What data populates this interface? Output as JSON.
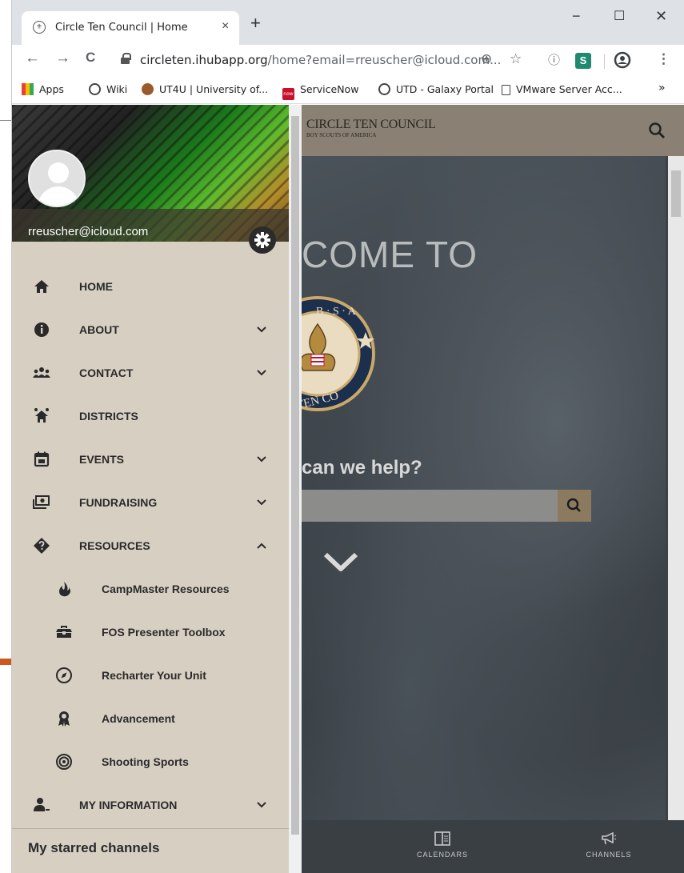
{
  "browser": {
    "tab_title": "Circle Ten Council | Home",
    "tab_close": "×",
    "new_tab": "+",
    "window_controls": {
      "minimize": "−",
      "maximize": "☐",
      "close": "✕"
    },
    "nav": {
      "back": "←",
      "forward": "→",
      "reload": "C"
    },
    "url_host": "circleten.ihubapp.org",
    "url_path": "/home?email=rreuscher@icloud.com...",
    "bookmarks": [
      "Apps",
      "Wiki",
      "UT4U | University of...",
      "ServiceNow",
      "UTD - Galaxy Portal",
      "VMware Server Acc..."
    ],
    "bookmarks_more": "»",
    "servicenow_badge": "now"
  },
  "site": {
    "brand": "CIRCLE TEN COUNCIL",
    "brand_sub": "BOY SCOUTS OF AMERICA",
    "welcome": "COME TO",
    "help_text": "can we help?",
    "seal_top": "B · S · A",
    "seal_bottom": "TEN CO",
    "bottom_tabs": [
      "CALENDARS",
      "CHANNELS"
    ]
  },
  "drawer": {
    "email": "rreuscher@icloud.com",
    "menu": [
      {
        "label": "HOME",
        "icon": "home-icon",
        "caret": ""
      },
      {
        "label": "ABOUT",
        "icon": "info-icon",
        "caret": "down"
      },
      {
        "label": "CONTACT",
        "icon": "people-icon",
        "caret": "down"
      },
      {
        "label": "DISTRICTS",
        "icon": "house-people-icon",
        "caret": ""
      },
      {
        "label": "EVENTS",
        "icon": "calendar-icon",
        "caret": "down"
      },
      {
        "label": "FUNDRAISING",
        "icon": "money-icon",
        "caret": "down"
      },
      {
        "label": "RESOURCES",
        "icon": "question-diamond-icon",
        "caret": "up"
      }
    ],
    "resources": [
      {
        "label": "CampMaster Resources",
        "icon": "fire-icon"
      },
      {
        "label": "FOS Presenter Toolbox",
        "icon": "toolbox-icon"
      },
      {
        "label": "Recharter Your Unit",
        "icon": "compass-icon"
      },
      {
        "label": "Advancement",
        "icon": "award-icon"
      },
      {
        "label": "Shooting Sports",
        "icon": "target-icon"
      }
    ],
    "my_information": "MY INFORMATION",
    "starred": "My starred channels"
  },
  "colors": {
    "drawer_bg": "#d8cfc3",
    "header_bg": "#8a8074",
    "search_btn": "#8c7a60",
    "arrow": "#d0571c"
  }
}
